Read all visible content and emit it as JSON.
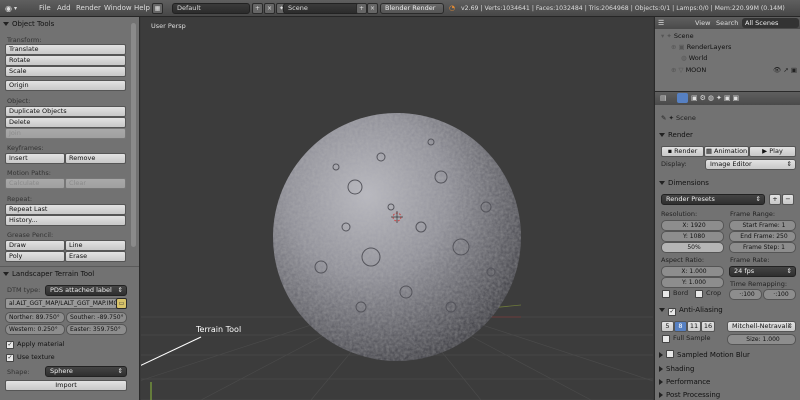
{
  "topbar": {
    "menus": [
      "File",
      "Add",
      "Render",
      "Window",
      "Help"
    ],
    "screen_layout": "Default",
    "scene_name": "Scene",
    "render_engine": "Blender Render",
    "stats": "v2.69 | Verts:1034641 | Faces:1032484 | Tris:2064968 | Objects:0/1 | Lamps:0/0 | Mem:220.99M (0.14M)"
  },
  "toolshelf": {
    "panel_title": "Object Tools",
    "transform_label": "Transform:",
    "translate": "Translate",
    "rotate": "Rotate",
    "scale": "Scale",
    "origin": "Origin",
    "object_label": "Object:",
    "duplicate_objects": "Duplicate Objects",
    "delete": "Delete",
    "join": "Join",
    "keyframes_label": "Keyframes:",
    "insert": "Insert",
    "remove": "Remove",
    "motion_paths_label": "Motion Paths:",
    "calculate": "Calculate",
    "clear": "Clear",
    "repeat_label": "Repeat:",
    "repeat_last": "Repeat Last",
    "history": "History...",
    "grease_pencil_label": "Grease Pencil:",
    "draw": "Draw",
    "line": "Line",
    "poly": "Poly",
    "erase": "Erase"
  },
  "terrain": {
    "panel_title": "Landscaper Terrain Tool",
    "dtm_type_label": "DTM type:",
    "dtm_type_value": "PDS attached label",
    "file_path": "al.ALT_GGT_MAP/LALT_GGT_MAP.IMG",
    "norther": "Norther: 89.750°",
    "souther": "Souther: -89.750°",
    "western": "Western: 0.250°",
    "easter": "Easter: 359.750°",
    "apply_material": "Apply material",
    "apply_material_checked": true,
    "use_texture": "Use texture",
    "use_texture_checked": true,
    "shape_label": "Shape:",
    "shape_value": "Sphere",
    "import": "Import"
  },
  "viewport": {
    "view_label": "User Persp",
    "annotation": "Terrain Tool"
  },
  "outliner": {
    "view": "View",
    "search": "Search",
    "all_scenes": "All Scenes",
    "scene": "Scene",
    "render_layers": "RenderLayers",
    "world": "World",
    "moon": "MOON"
  },
  "properties": {
    "breadcrumb": "Scene",
    "render_section": "Render",
    "render_btn": "Render",
    "animation_btn": "Animation",
    "play_btn": "Play",
    "display_label": "Display:",
    "display_value": "Image Editor",
    "dimensions_section": "Dimensions",
    "render_presets": "Render Presets",
    "resolution_label": "Resolution:",
    "res_x": "X: 1920",
    "res_y": "Y: 1080",
    "res_pct": "50%",
    "frame_range_label": "Frame Range:",
    "start_frame": "Start Frame: 1",
    "end_frame": "End Frame: 250",
    "frame_step": "Frame Step: 1",
    "aspect_label": "Aspect Ratio:",
    "aspect_x": "X: 1.000",
    "aspect_y": "Y: 1.000",
    "frame_rate_label": "Frame Rate:",
    "frame_rate": "24 fps",
    "border": "Bord",
    "crop": "Crop",
    "time_remap_label": "Time Remapping:",
    "remap_old": "·:100",
    "remap_new": "·:100",
    "aa_section": "Anti-Aliasing",
    "aa_samples": [
      "5",
      "8",
      "11",
      "16"
    ],
    "aa_selected": "8",
    "aa_filter": "Mitchell-Netravali",
    "full_sample": "Full Sample",
    "size": "Size: 1.000",
    "motion_blur": "Sampled Motion Blur",
    "shading": "Shading",
    "performance": "Performance",
    "post_processing": "Post Processing"
  },
  "colors": {
    "panel_bg": "#727272",
    "viewport_bg": "#3c3c3c",
    "accent_blue": "#5680c2",
    "moon": "#8d8d96"
  }
}
